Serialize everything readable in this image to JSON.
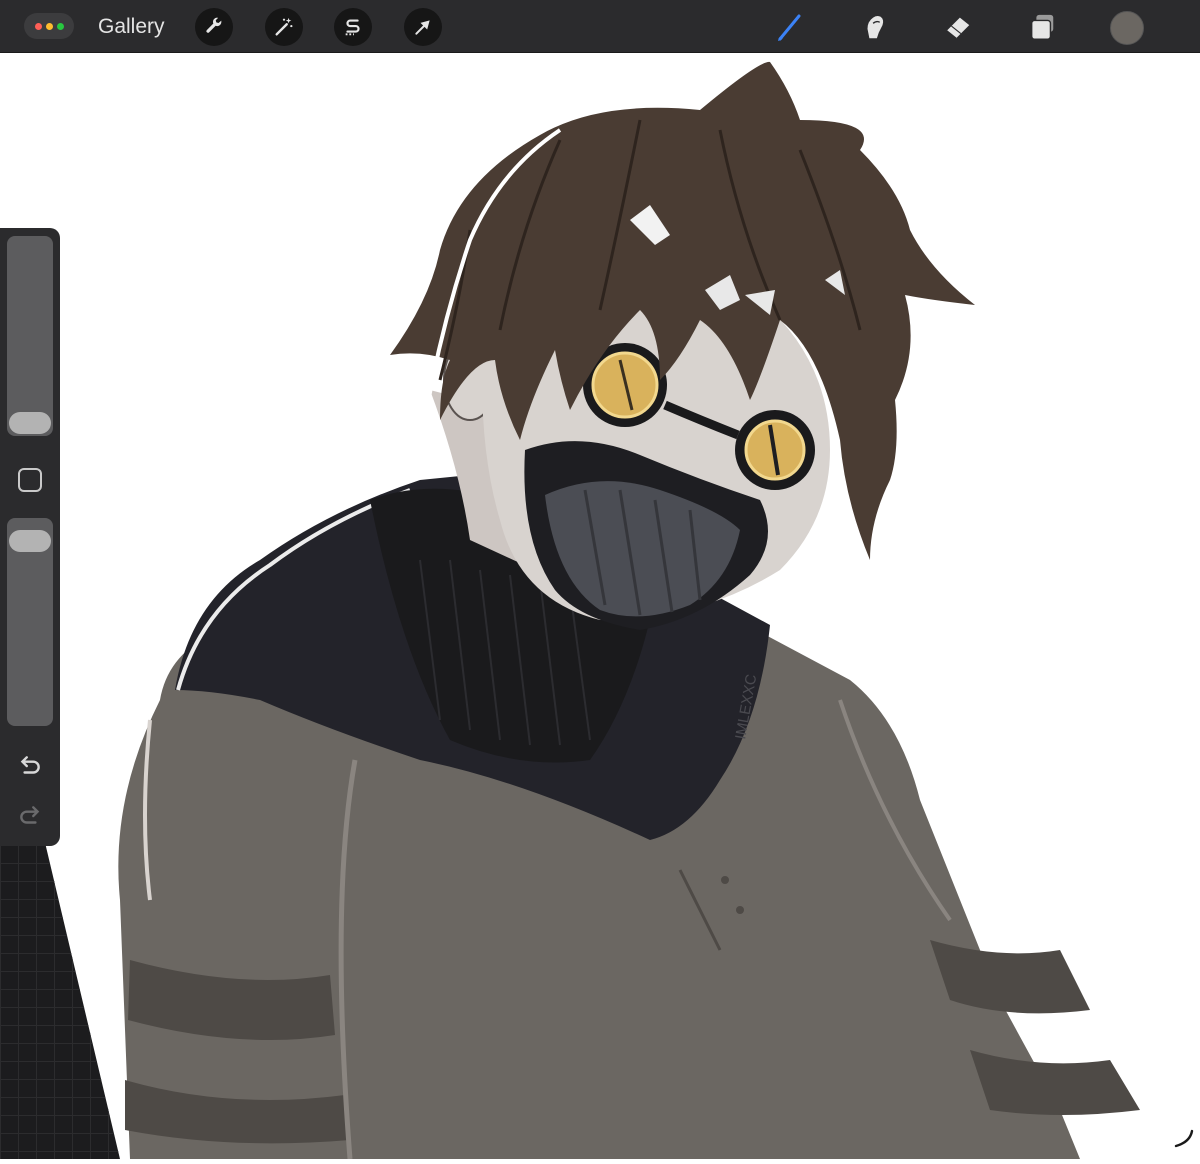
{
  "toolbar": {
    "gallery_label": "Gallery",
    "left_tools": [
      {
        "name": "actions",
        "icon": "wrench-icon"
      },
      {
        "name": "adjustments",
        "icon": "magic-wand-icon"
      },
      {
        "name": "selection",
        "icon": "selection-s-icon"
      },
      {
        "name": "transform",
        "icon": "arrow-cursor-icon"
      }
    ],
    "right_tools": [
      {
        "name": "brush",
        "icon": "brush-icon",
        "active": true
      },
      {
        "name": "smudge",
        "icon": "smudge-finger-icon",
        "active": false
      },
      {
        "name": "eraser",
        "icon": "eraser-icon",
        "active": false
      },
      {
        "name": "layers",
        "icon": "layers-icon",
        "active": false
      }
    ],
    "current_color": "#6b6762",
    "active_tool_color": "#3b82f6"
  },
  "sidebar": {
    "brush_size_level": 0.1,
    "opacity_level": 0.95,
    "buttons": [
      {
        "name": "modify",
        "icon": "square-modify-icon"
      },
      {
        "name": "undo",
        "icon": "undo-arrow-icon"
      },
      {
        "name": "redo",
        "icon": "redo-arrow-icon"
      }
    ]
  },
  "canvas": {
    "artwork": "illustration-masked-character",
    "background": "#ffffff"
  },
  "artwork_signature": "IMLEXXC",
  "colors": {
    "toolbar_bg": "#2b2b2d",
    "hair": "#4a3c33",
    "sweater": "#6b6762",
    "hood": "#23232a",
    "goggle_lens": "#d9b25c",
    "mask": "#4b4d54",
    "skin": "#d8d3cf"
  }
}
